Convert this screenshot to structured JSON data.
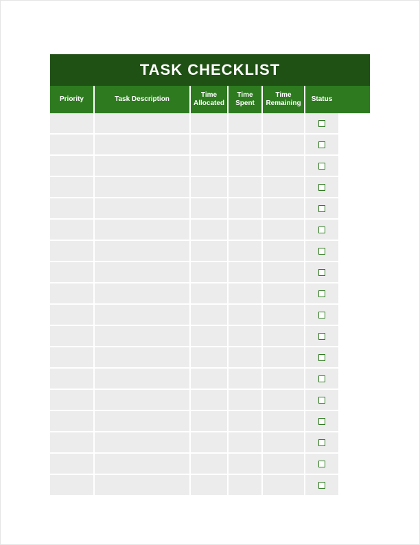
{
  "title": "TASK CHECKLIST",
  "columns": {
    "priority": "Priority",
    "desc": "Task Description",
    "alloc": "Time Allocated",
    "spent": "Time Spent",
    "remain": "Time Remaining",
    "status": "Status"
  },
  "rows": [
    {
      "priority": "",
      "desc": "",
      "alloc": "",
      "spent": "",
      "remain": "",
      "status": false
    },
    {
      "priority": "",
      "desc": "",
      "alloc": "",
      "spent": "",
      "remain": "",
      "status": false
    },
    {
      "priority": "",
      "desc": "",
      "alloc": "",
      "spent": "",
      "remain": "",
      "status": false
    },
    {
      "priority": "",
      "desc": "",
      "alloc": "",
      "spent": "",
      "remain": "",
      "status": false
    },
    {
      "priority": "",
      "desc": "",
      "alloc": "",
      "spent": "",
      "remain": "",
      "status": false
    },
    {
      "priority": "",
      "desc": "",
      "alloc": "",
      "spent": "",
      "remain": "",
      "status": false
    },
    {
      "priority": "",
      "desc": "",
      "alloc": "",
      "spent": "",
      "remain": "",
      "status": false
    },
    {
      "priority": "",
      "desc": "",
      "alloc": "",
      "spent": "",
      "remain": "",
      "status": false
    },
    {
      "priority": "",
      "desc": "",
      "alloc": "",
      "spent": "",
      "remain": "",
      "status": false
    },
    {
      "priority": "",
      "desc": "",
      "alloc": "",
      "spent": "",
      "remain": "",
      "status": false
    },
    {
      "priority": "",
      "desc": "",
      "alloc": "",
      "spent": "",
      "remain": "",
      "status": false
    },
    {
      "priority": "",
      "desc": "",
      "alloc": "",
      "spent": "",
      "remain": "",
      "status": false
    },
    {
      "priority": "",
      "desc": "",
      "alloc": "",
      "spent": "",
      "remain": "",
      "status": false
    },
    {
      "priority": "",
      "desc": "",
      "alloc": "",
      "spent": "",
      "remain": "",
      "status": false
    },
    {
      "priority": "",
      "desc": "",
      "alloc": "",
      "spent": "",
      "remain": "",
      "status": false
    },
    {
      "priority": "",
      "desc": "",
      "alloc": "",
      "spent": "",
      "remain": "",
      "status": false
    },
    {
      "priority": "",
      "desc": "",
      "alloc": "",
      "spent": "",
      "remain": "",
      "status": false
    },
    {
      "priority": "",
      "desc": "",
      "alloc": "",
      "spent": "",
      "remain": "",
      "status": false
    }
  ]
}
